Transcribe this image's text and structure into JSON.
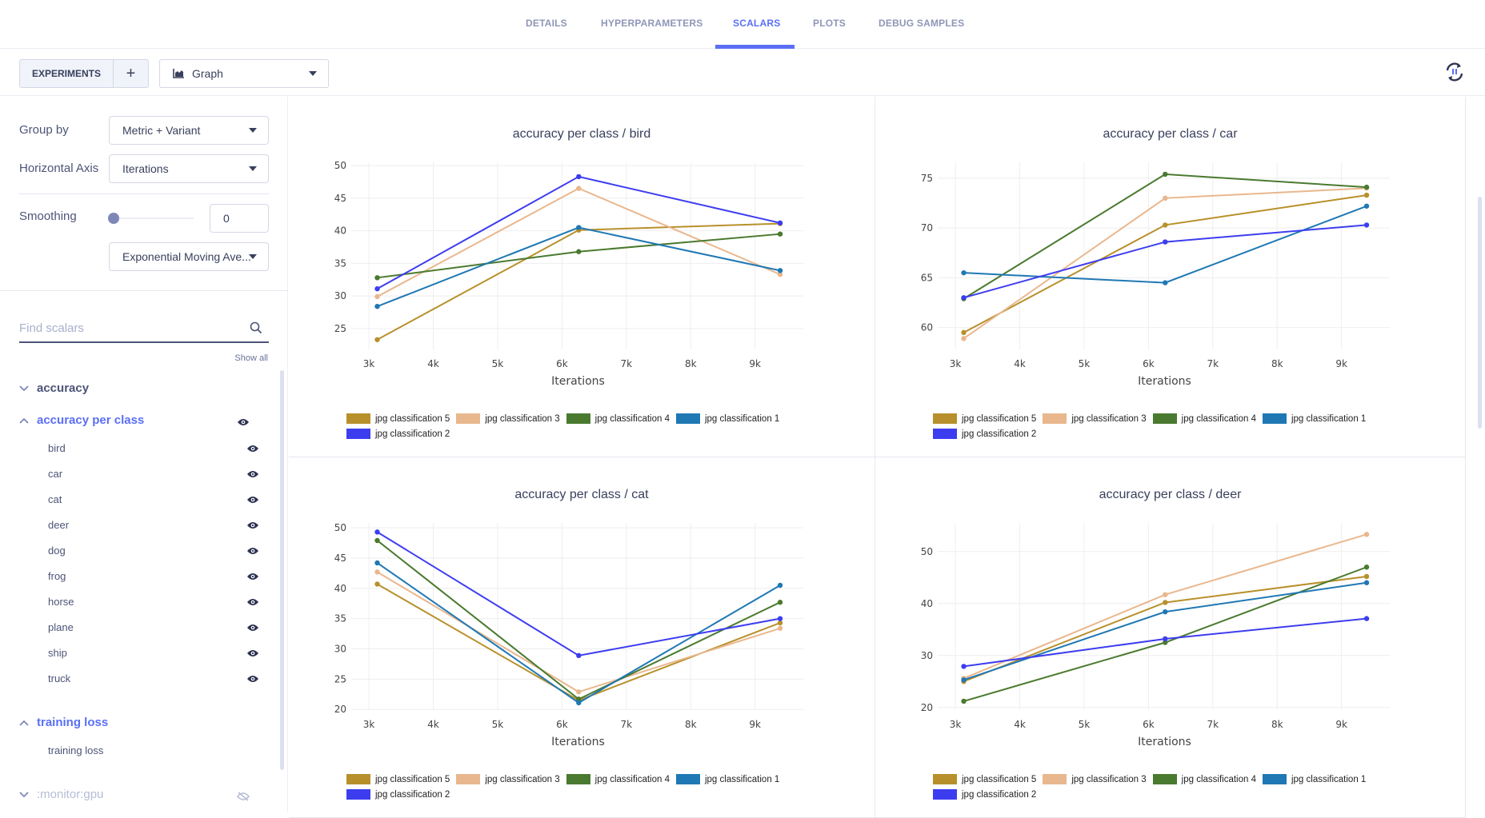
{
  "tabs": [
    {
      "label": "DETAILS",
      "active": false
    },
    {
      "label": "HYPERPARAMETERS",
      "active": false
    },
    {
      "label": "SCALARS",
      "active": true
    },
    {
      "label": "PLOTS",
      "active": false
    },
    {
      "label": "DEBUG SAMPLES",
      "active": false
    }
  ],
  "toolbar": {
    "experiments_label": "EXPERIMENTS",
    "add_label": "+",
    "view_select": "Graph",
    "view_icon": "area-chart-icon",
    "refresh_icon": "auto-refresh-pause-icon"
  },
  "settings": {
    "group_by_label": "Group by",
    "group_by_value": "Metric + Variant",
    "horizontal_axis_label": "Horizontal Axis",
    "horizontal_axis_value": "Iterations",
    "smoothing_label": "Smoothing",
    "smoothing_value": "0",
    "smoothing_slider_fraction": 0,
    "smoothing_method": "Exponential Moving Ave..."
  },
  "scalars": {
    "search_placeholder": "Find scalars",
    "show_all": "Show all",
    "groups": [
      {
        "label": "accuracy",
        "expanded": false,
        "visible": true,
        "children": []
      },
      {
        "label": "accuracy per class",
        "expanded": true,
        "visible": true,
        "children": [
          "bird",
          "car",
          "cat",
          "deer",
          "dog",
          "frog",
          "horse",
          "plane",
          "ship",
          "truck"
        ]
      },
      {
        "label": "training loss",
        "expanded": true,
        "visible": true,
        "children": [
          "training loss"
        ]
      },
      {
        "label": ":monitor:gpu",
        "expanded": false,
        "visible": false,
        "children": []
      }
    ]
  },
  "colors": {
    "accent": "#5a6ff6",
    "jpg classification 5": "#b8902b",
    "jpg classification 3": "#e9b78d",
    "jpg classification 4": "#4a7a2f",
    "jpg classification 1": "#1f78b4",
    "jpg classification 2": "#3d3df0"
  },
  "chart_data": [
    {
      "type": "line",
      "title": "accuracy per class / bird",
      "xlabel": "Iterations",
      "ylabel": "",
      "x": [
        3130,
        6260,
        9390
      ],
      "xlim": [
        2850,
        9750
      ],
      "ylim": [
        21.8,
        50.5
      ],
      "xticks": [
        3000,
        4000,
        5000,
        6000,
        7000,
        8000,
        9000
      ],
      "xtick_labels": [
        "3k",
        "4k",
        "5k",
        "6k",
        "7k",
        "8k",
        "9k"
      ],
      "yticks": [
        25,
        30,
        35,
        40,
        45,
        50
      ],
      "grid": true,
      "legend_position": "bottom",
      "series": [
        {
          "name": "jpg classification 5",
          "values": [
            23.3,
            40.1,
            41.1
          ]
        },
        {
          "name": "jpg classification 3",
          "values": [
            29.9,
            46.5,
            33.3
          ]
        },
        {
          "name": "jpg classification 4",
          "values": [
            32.8,
            36.8,
            39.5
          ]
        },
        {
          "name": "jpg classification 1",
          "values": [
            28.4,
            40.5,
            33.9
          ]
        },
        {
          "name": "jpg classification 2",
          "values": [
            31.1,
            48.3,
            41.2
          ]
        }
      ]
    },
    {
      "type": "line",
      "title": "accuracy per class / car",
      "xlabel": "Iterations",
      "ylabel": "",
      "x": [
        3130,
        6260,
        9390
      ],
      "xlim": [
        2850,
        9750
      ],
      "ylim": [
        57.8,
        76.6
      ],
      "xticks": [
        3000,
        4000,
        5000,
        6000,
        7000,
        8000,
        9000
      ],
      "xtick_labels": [
        "3k",
        "4k",
        "5k",
        "6k",
        "7k",
        "8k",
        "9k"
      ],
      "yticks": [
        60,
        65,
        70,
        75
      ],
      "grid": true,
      "legend_position": "bottom",
      "series": [
        {
          "name": "jpg classification 5",
          "values": [
            59.5,
            70.3,
            73.3
          ]
        },
        {
          "name": "jpg classification 3",
          "values": [
            58.9,
            73.0,
            74.0
          ]
        },
        {
          "name": "jpg classification 4",
          "values": [
            62.9,
            75.4,
            74.1
          ]
        },
        {
          "name": "jpg classification 1",
          "values": [
            65.5,
            64.5,
            72.2
          ]
        },
        {
          "name": "jpg classification 2",
          "values": [
            63.0,
            68.6,
            70.3
          ]
        }
      ]
    },
    {
      "type": "line",
      "title": "accuracy per class / cat",
      "xlabel": "Iterations",
      "ylabel": "",
      "x": [
        3130,
        6260,
        9390
      ],
      "xlim": [
        2850,
        9750
      ],
      "ylim": [
        19.9,
        50.8
      ],
      "xticks": [
        3000,
        4000,
        5000,
        6000,
        7000,
        8000,
        9000
      ],
      "xtick_labels": [
        "3k",
        "4k",
        "5k",
        "6k",
        "7k",
        "8k",
        "9k"
      ],
      "yticks": [
        20,
        25,
        30,
        35,
        40,
        45,
        50
      ],
      "grid": true,
      "legend_position": "bottom",
      "series": [
        {
          "name": "jpg classification 5",
          "values": [
            40.7,
            21.5,
            34.3
          ]
        },
        {
          "name": "jpg classification 3",
          "values": [
            42.7,
            22.9,
            33.4
          ]
        },
        {
          "name": "jpg classification 4",
          "values": [
            47.9,
            21.7,
            37.7
          ]
        },
        {
          "name": "jpg classification 1",
          "values": [
            44.2,
            21.1,
            40.5
          ]
        },
        {
          "name": "jpg classification 2",
          "values": [
            49.3,
            28.9,
            35.0
          ]
        }
      ]
    },
    {
      "type": "line",
      "title": "accuracy per class / deer",
      "xlabel": "Iterations",
      "ylabel": "",
      "x": [
        3130,
        6260,
        9390
      ],
      "xlim": [
        2850,
        9750
      ],
      "ylim": [
        19.5,
        55.5
      ],
      "xticks": [
        3000,
        4000,
        5000,
        6000,
        7000,
        8000,
        9000
      ],
      "xtick_labels": [
        "3k",
        "4k",
        "5k",
        "6k",
        "7k",
        "8k",
        "9k"
      ],
      "yticks": [
        20,
        30,
        40,
        50
      ],
      "grid": true,
      "legend_position": "bottom",
      "series": [
        {
          "name": "jpg classification 5",
          "values": [
            25.0,
            40.2,
            45.2
          ]
        },
        {
          "name": "jpg classification 3",
          "values": [
            25.6,
            41.7,
            53.3
          ]
        },
        {
          "name": "jpg classification 4",
          "values": [
            21.2,
            32.5,
            47.0
          ]
        },
        {
          "name": "jpg classification 1",
          "values": [
            25.3,
            38.4,
            44.0
          ]
        },
        {
          "name": "jpg classification 2",
          "values": [
            27.9,
            33.2,
            37.1
          ]
        }
      ]
    }
  ]
}
